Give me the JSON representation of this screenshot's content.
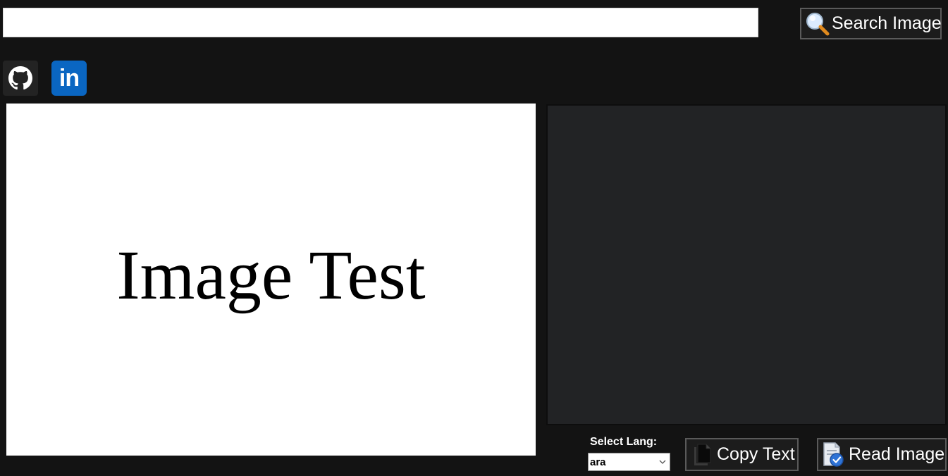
{
  "search": {
    "path_value": "",
    "button_label": "Search Image",
    "icon": "magnifier-icon"
  },
  "social": {
    "github_icon": "github-icon",
    "linkedin_label": "in",
    "linkedin_icon": "linkedin-icon"
  },
  "preview": {
    "text": "Image Test"
  },
  "output": {
    "text": ""
  },
  "language": {
    "label": "Select Lang:",
    "selected": "ara"
  },
  "actions": {
    "copy_label": "Copy Text",
    "copy_icon": "copy-document-icon",
    "read_label": "Read Image",
    "read_icon": "read-image-icon"
  },
  "colors": {
    "background": "#131313",
    "button_bg": "#1c1c1c",
    "button_border": "#5a5a5a",
    "output_bg": "#222325",
    "linkedin_blue": "#0a66c2"
  }
}
